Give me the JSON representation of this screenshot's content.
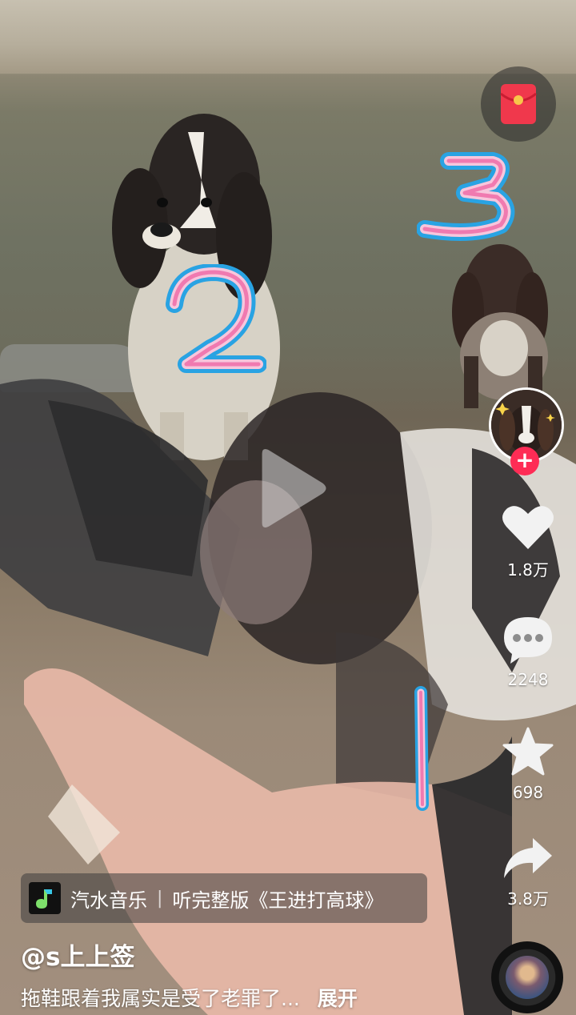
{
  "actions": {
    "like_count": "1.8万",
    "comment_count": "2248",
    "favorite_count": "698",
    "share_count": "3.8万"
  },
  "music": {
    "app_name": "汽水音乐",
    "separator": "|",
    "song_text": "听完整版《王进打高球》"
  },
  "post": {
    "username": "@s上上签",
    "caption": "拖鞋跟着我属实是受了老罪了...",
    "expand_label": "展开"
  },
  "stickers": [
    "2",
    "3",
    "1"
  ],
  "colors": {
    "like_red": "#fe2c55",
    "sticker_blue": "#29a3e3",
    "sticker_pink": "#f07ab0",
    "sticker_light_pink": "#f7c6dc"
  },
  "icons": {
    "red_packet": "red-envelope-icon",
    "like": "heart-icon",
    "comment": "comment-bubble-icon",
    "favorite": "star-icon",
    "share": "share-arrow-icon",
    "play": "play-icon",
    "follow": "plus-icon",
    "music_app": "music-note-icon"
  }
}
